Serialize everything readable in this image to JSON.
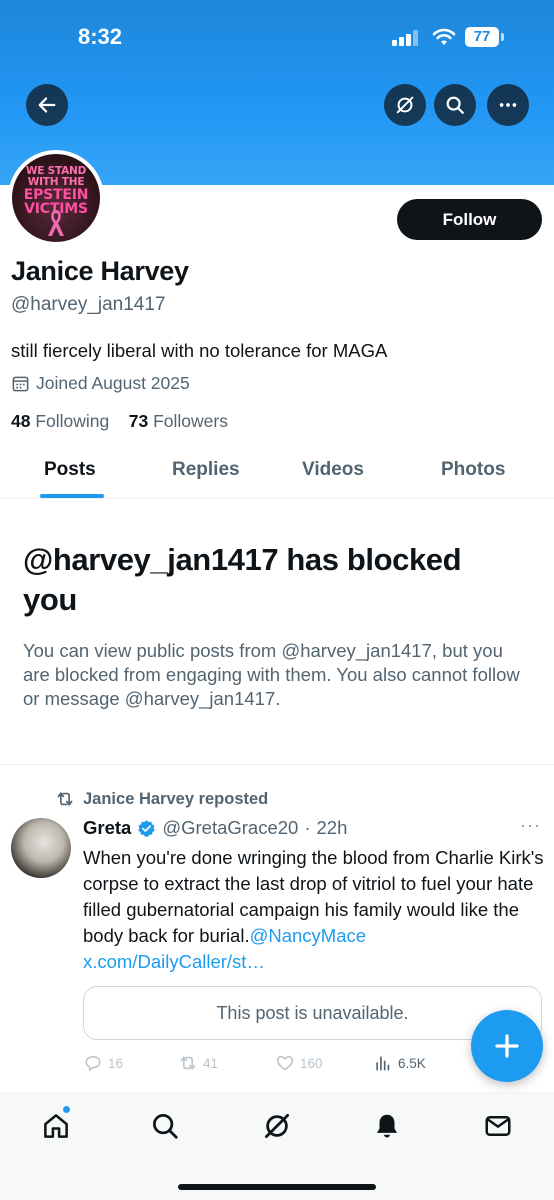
{
  "status_bar": {
    "time": "8:32",
    "battery": "77"
  },
  "header": {
    "back_icon": "arrow-left-icon",
    "grok_icon": "grok-icon",
    "search_icon": "search-icon",
    "more_icon": "ellipsis-icon"
  },
  "profile": {
    "avatar_lines": [
      "WE STAND",
      "WITH THE",
      "EPSTEIN",
      "VICTIMS"
    ],
    "follow_label": "Follow",
    "display_name": "Janice Harvey",
    "handle": "@harvey_jan1417",
    "bio": "still fiercely liberal with no tolerance for MAGA",
    "joined": "Joined August 2025",
    "following_count": "48",
    "following_label": "Following",
    "followers_count": "73",
    "followers_label": "Followers"
  },
  "tabs": [
    {
      "label": "Posts",
      "active": true
    },
    {
      "label": "Replies",
      "active": false
    },
    {
      "label": "Videos",
      "active": false
    },
    {
      "label": "Photos",
      "active": false
    }
  ],
  "blocked": {
    "title": "@harvey_jan1417 has blocked you",
    "body": "You can view public posts from @harvey_jan1417, but you are blocked from engaging with them. You also cannot follow or message @harvey_jan1417."
  },
  "post": {
    "repost_label": "Janice Harvey reposted",
    "author_name": "Greta",
    "author_handle": "@GretaGrace20",
    "separator": "·",
    "time": "22h",
    "more": "···",
    "text": "When you're done wringing the blood from Charlie Kirk's corpse to extract the last drop of vitriol to fuel your hate filled gubernatorial campaign his family would like the body back for burial.",
    "mention": "@NancyMace",
    "link": "x.com/DailyCaller/st…",
    "quote": "This post is unavailable.",
    "replies": "16",
    "reposts": "41",
    "likes": "160",
    "views": "6.5K"
  },
  "colors": {
    "accent": "#1d9bf0",
    "banner": "#2196f3",
    "text": "#0f1419",
    "muted": "#536471"
  },
  "bottom_nav": [
    "home-icon",
    "search-icon",
    "grok-icon",
    "notifications-icon",
    "messages-icon"
  ]
}
